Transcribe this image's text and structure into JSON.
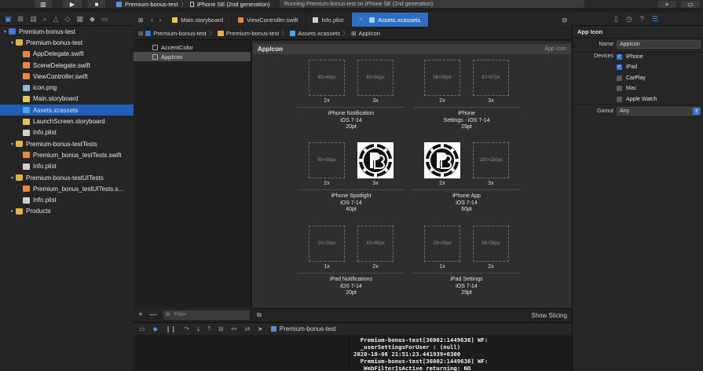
{
  "toolbar": {
    "scheme_target": "Premium-bonus-test",
    "scheme_device": "iPhone SE (2nd generation)",
    "status": "Running Premium-bonus-test on iPhone SE (2nd generation)",
    "add_symbol": "+",
    "layout_symbol": "▭"
  },
  "navigator": {
    "items": [
      {
        "label": "Premium-bonus-test",
        "depth": 0,
        "chev": "▾",
        "icon": "proj"
      },
      {
        "label": "Premium-bonus-test",
        "depth": 1,
        "chev": "▾",
        "icon": "folder"
      },
      {
        "label": "AppDelegate.swift",
        "depth": 2,
        "chev": "",
        "icon": "swift"
      },
      {
        "label": "SceneDelegate.swift",
        "depth": 2,
        "chev": "",
        "icon": "swift"
      },
      {
        "label": "ViewController.swift",
        "depth": 2,
        "chev": "",
        "icon": "swift"
      },
      {
        "label": "icon.png",
        "depth": 2,
        "chev": "",
        "icon": "png"
      },
      {
        "label": "Main.storyboard",
        "depth": 2,
        "chev": "",
        "icon": "sb"
      },
      {
        "label": "Assets.xcassets",
        "depth": 2,
        "chev": "",
        "icon": "assets",
        "selected": true
      },
      {
        "label": "LaunchScreen.storyboard",
        "depth": 2,
        "chev": "",
        "icon": "sb"
      },
      {
        "label": "Info.plist",
        "depth": 2,
        "chev": "",
        "icon": "plist"
      },
      {
        "label": "Premium-bonus-testTests",
        "depth": 1,
        "chev": "▾",
        "icon": "folder"
      },
      {
        "label": "Premium_bonus_testTests.swift",
        "depth": 2,
        "chev": "",
        "icon": "swift"
      },
      {
        "label": "Info.plist",
        "depth": 2,
        "chev": "",
        "icon": "plist"
      },
      {
        "label": "Premium-bonus-testUITests",
        "depth": 1,
        "chev": "▾",
        "icon": "folder"
      },
      {
        "label": "Premium_bonus_testUITests.s...",
        "depth": 2,
        "chev": "",
        "icon": "swift"
      },
      {
        "label": "Info.plist",
        "depth": 2,
        "chev": "",
        "icon": "plist"
      },
      {
        "label": "Products",
        "depth": 1,
        "chev": "▸",
        "icon": "folder"
      }
    ]
  },
  "tabs": [
    {
      "label": "Main.storyboard",
      "active": false
    },
    {
      "label": "ViewController.swift",
      "active": false
    },
    {
      "label": "Info.plist",
      "active": false
    },
    {
      "label": "Assets.xcassets",
      "active": true
    }
  ],
  "jumpbar": {
    "items": [
      "Premium-bonus-test",
      "Premium-bonus-test",
      "Assets.xcassets",
      "AppIcon"
    ]
  },
  "asset_list": {
    "items": [
      {
        "label": "AccentColor",
        "selected": false
      },
      {
        "label": "AppIcon",
        "selected": true
      }
    ],
    "filter_placeholder": "Filter",
    "add": "+",
    "remove": "—"
  },
  "detail": {
    "name": "AppIcon",
    "type": "App Icon",
    "groups": [
      {
        "slots": [
          {
            "size": "40×40px",
            "scale": "2x"
          },
          {
            "size": "60×60px",
            "scale": "3x"
          }
        ],
        "caption": [
          "iPhone Notification",
          "iOS 7-14",
          "20pt"
        ]
      },
      {
        "slots": [
          {
            "size": "58×58px",
            "scale": "2x"
          },
          {
            "size": "87×87px",
            "scale": "3x"
          }
        ],
        "caption": [
          "iPhone",
          "Settings - iOS 7-14",
          "29pt"
        ]
      },
      {
        "slots": [
          {
            "size": "80×80px",
            "scale": "2x"
          },
          {
            "size": "",
            "scale": "3x",
            "filled": true
          }
        ],
        "caption": [
          "iPhone Spotlight",
          "iOS 7-14",
          "40pt"
        ]
      },
      {
        "slots": [
          {
            "size": "",
            "scale": "2x",
            "filled": true
          },
          {
            "size": "180×180px",
            "scale": "3x"
          }
        ],
        "caption": [
          "iPhone App",
          "iOS 7-14",
          "60pt"
        ]
      },
      {
        "slots": [
          {
            "size": "20×20px",
            "scale": "1x"
          },
          {
            "size": "40×40px",
            "scale": "2x"
          }
        ],
        "caption": [
          "iPad Notifications",
          "iOS 7-14",
          "20pt"
        ]
      },
      {
        "slots": [
          {
            "size": "29×29px",
            "scale": "1x"
          },
          {
            "size": "58×58px",
            "scale": "2x"
          }
        ],
        "caption": [
          "iPad Settings",
          "iOS 7-14",
          "29pt"
        ]
      }
    ],
    "show_slicing": "Show Slicing"
  },
  "debug": {
    "target": "Premium-bonus-test"
  },
  "console": {
    "lines": [
      "  Premium-bonus-test[36002:1449636] WF:",
      "  _userSettingsForUser : (null)",
      "2020-10-06 21:51:23.441939+0300",
      "  Premium-bonus-test[36002:1449636] WF:",
      "  _WebFilterIsActive returning: NO"
    ]
  },
  "inspector": {
    "title": "App Icon",
    "name_label": "Name",
    "name_value": "AppIcon",
    "devices_label": "Devices",
    "devices": [
      {
        "label": "iPhone",
        "checked": true
      },
      {
        "label": "iPad",
        "checked": true
      },
      {
        "label": "CarPlay",
        "checked": false
      },
      {
        "label": "Mac",
        "checked": false
      },
      {
        "label": "Apple Watch",
        "checked": false
      }
    ],
    "gamut_label": "Gamut",
    "gamut_value": "Any"
  }
}
